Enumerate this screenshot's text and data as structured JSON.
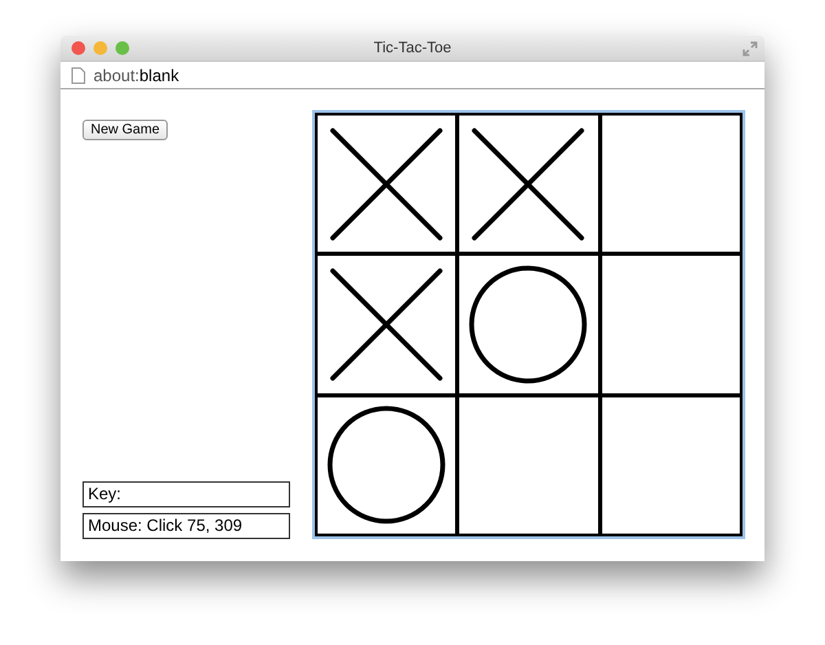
{
  "window": {
    "title": "Tic-Tac-Toe"
  },
  "address_bar": {
    "prefix": "about:",
    "page": "blank"
  },
  "new_game_button": "New Game",
  "board": {
    "focused": true,
    "cells": [
      {
        "kind": "x"
      },
      {
        "kind": "x"
      },
      {
        "kind": "empty"
      },
      {
        "kind": "x"
      },
      {
        "kind": "o"
      },
      {
        "kind": "empty"
      },
      {
        "kind": "o"
      },
      {
        "kind": "empty"
      },
      {
        "kind": "empty"
      }
    ]
  },
  "status": {
    "key": "Key:",
    "mouse": "Mouse: Click 75, 309"
  }
}
